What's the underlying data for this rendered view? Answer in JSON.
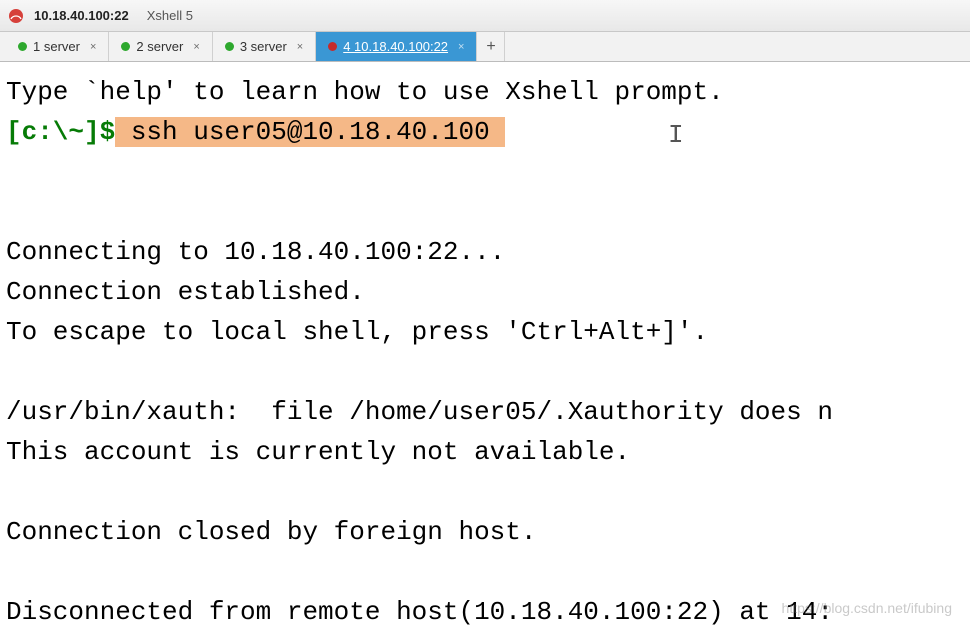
{
  "window": {
    "title": "10.18.40.100:22",
    "app_name": "Xshell 5"
  },
  "tabs": [
    {
      "dot": "green",
      "label": "1 server",
      "active": false
    },
    {
      "dot": "green",
      "label": "2 server",
      "active": false
    },
    {
      "dot": "green",
      "label": "3 server",
      "active": false
    },
    {
      "dot": "red",
      "label": "4 10.18.40.100:22",
      "active": true
    }
  ],
  "newtab_label": "+",
  "terminal": {
    "line1": "Type `help' to learn how to use Xshell prompt.",
    "prompt": "[c:\\~]$",
    "command": " ssh user05@10.18.40.100 ",
    "body": "\n\n\nConnecting to 10.18.40.100:22...\nConnection established.\nTo escape to local shell, press 'Ctrl+Alt+]'.\n\n/usr/bin/xauth:  file /home/user05/.Xauthority does n\nThis account is currently not available.\n\nConnection closed by foreign host.\n\nDisconnected from remote host(10.18.40.100:22) at 14:"
  },
  "watermark": "https://blog.csdn.net/ifubing"
}
